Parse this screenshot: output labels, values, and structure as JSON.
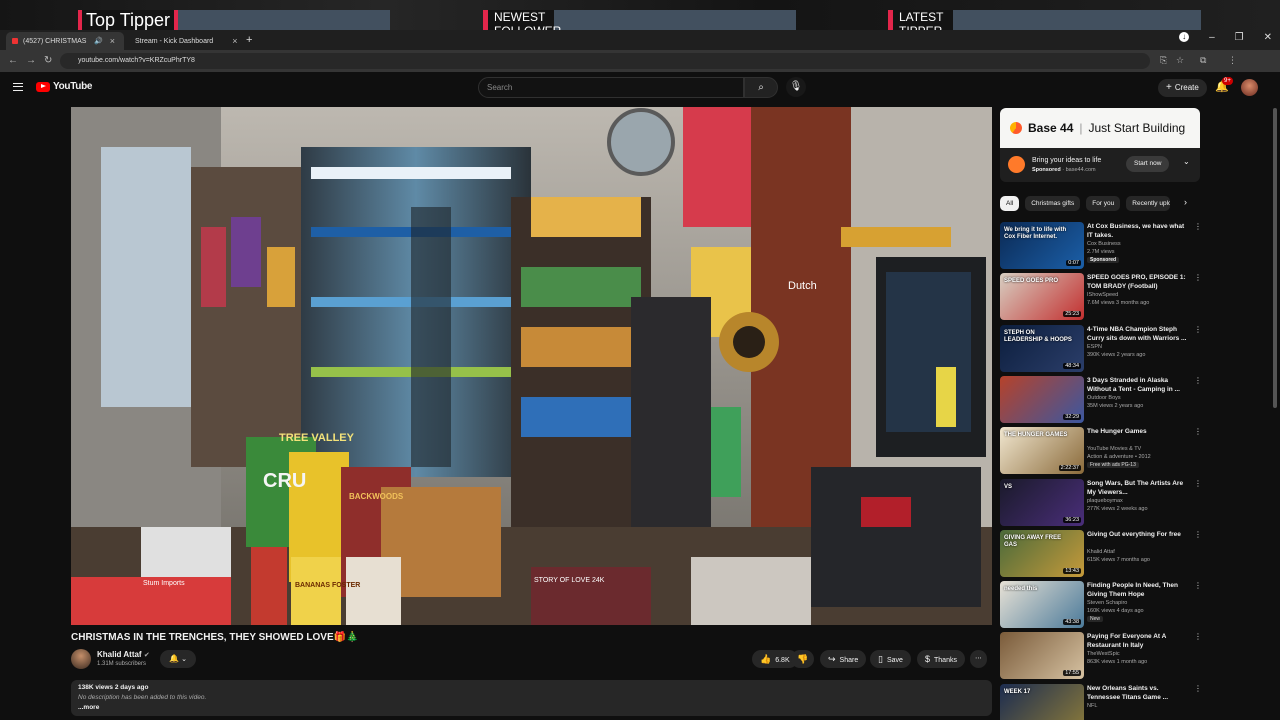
{
  "overlay": {
    "top_tipper": "Top Tipper",
    "newest_follower": "NEWEST FOLLOWER",
    "latest_tipper": "LATEST TIPPER"
  },
  "browser": {
    "tabs": [
      {
        "label": "(4527) CHRISTMAS IN THE",
        "active": true
      },
      {
        "label": "Stream - Kick Dashboard",
        "active": false
      }
    ],
    "new_tab": "+",
    "url": "youtube.com/watch?v=KRZcuPhrTY8"
  },
  "youtube": {
    "logo_text": "YouTube",
    "search_placeholder": "Search",
    "create_label": "Create",
    "notifications_count": "9+"
  },
  "video": {
    "title": "CHRISTMAS IN THE TRENCHES, THEY SHOWED LOVE🎁🎄",
    "channel_name": "Khalid Attaf",
    "subscribers": "1.31M subscribers",
    "likes": "6.8K",
    "share_label": "Share",
    "save_label": "Save",
    "thanks_label": "Thanks",
    "views_age": "138K views  2 days ago",
    "description": "No description has been added to this video.",
    "more_label": "...more",
    "scene_labels": {
      "dutch": "Dutch",
      "cru": "CRU",
      "valley": "TREE VALLEY",
      "backwoods": "BACKWOODS",
      "bananas": "BANANAS FOSTER",
      "story": "STORY OF LOVE 24K",
      "stum": "Stum Imports"
    }
  },
  "ad": {
    "brand": "Base 44",
    "tagline": "Just Start Building",
    "headline": "Bring your ideas to life",
    "sponsored": "Sponsored",
    "domain": "base44.com",
    "cta": "Start now"
  },
  "chips": [
    "All",
    "Christmas gifts",
    "For you",
    "Recently uploaded"
  ],
  "recommendations": [
    {
      "title": "At Cox Business, we have what IT takes.",
      "channel": "Cox Business",
      "meta": "2.7M views",
      "extra": "Sponsored",
      "duration": "0:07",
      "thumb_text": "We bring it to life with Cox Fiber Internet."
    },
    {
      "title": "SPEED GOES PRO, EPISODE 1: TOM BRADY (Football)",
      "channel": "IShowSpeed",
      "meta": "7.6M views  3 months ago",
      "extra": "",
      "duration": "25:23",
      "thumb_text": "SPEED GOES PRO"
    },
    {
      "title": "4-Time NBA Champion Steph Curry sits down with Warriors ...",
      "channel": "ESPN",
      "meta": "390K views  2 years ago",
      "extra": "",
      "duration": "48:34",
      "thumb_text": "STEPH ON LEADERSHIP & HOOPS"
    },
    {
      "title": "3 Days Stranded in Alaska Without a Tent - Camping in ...",
      "channel": "Outdoor Boys",
      "meta": "35M views  2 years ago",
      "extra": "",
      "duration": "32:29",
      "thumb_text": ""
    },
    {
      "title": "The Hunger Games",
      "channel": "YouTube Movies & TV",
      "meta": "Action & adventure • 2012",
      "extra": "Free with ads  PG-13",
      "duration": "2:22:37",
      "thumb_text": "THE HUNGER GAMES"
    },
    {
      "title": "Song Wars, But The Artists Are My Viewers...",
      "channel": "plaqueboymax",
      "meta": "277K views  2 weeks ago",
      "extra": "",
      "duration": "36:23",
      "thumb_text": "VS"
    },
    {
      "title": "Giving Out everything For free",
      "channel": "Khalid Attaf",
      "meta": "615K views  7 months ago",
      "extra": "",
      "duration": "13:43",
      "thumb_text": "GIVING AWAY FREE GAS"
    },
    {
      "title": "Finding People In Need, Then Giving Them Hope",
      "channel": "Steven Schapiro",
      "meta": "160K views  4 days ago",
      "extra": "New",
      "duration": "43:38",
      "thumb_text": "needed this"
    },
    {
      "title": "Paying For Everyone At A Restaurant In Italy",
      "channel": "TheWestSpic",
      "meta": "863K views  1 month ago",
      "extra": "",
      "duration": "17:55",
      "thumb_text": ""
    },
    {
      "title": "New Orleans Saints vs. Tennessee Titans Game ...",
      "channel": "NFL",
      "meta": "",
      "extra": "",
      "duration": "",
      "thumb_text": "WEEK 17"
    }
  ],
  "colors": {
    "bg": "#0f0f0f",
    "accent_red": "#ff0000",
    "overlay_red": "#e3264b",
    "kick_green": "#53fc18"
  }
}
